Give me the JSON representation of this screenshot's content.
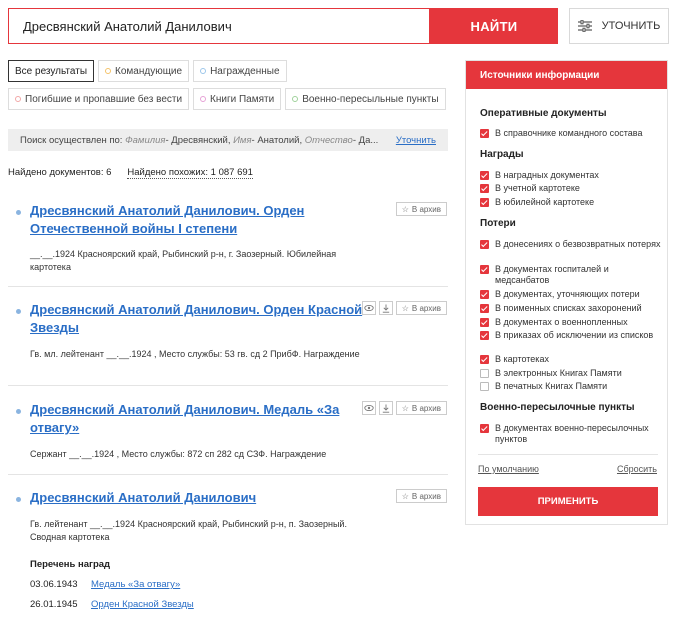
{
  "search": {
    "value": "Дресвянский Анатолий Данилович",
    "button": "НАЙТИ",
    "refine": "УТОЧНИТЬ",
    "accent": "#e5363c"
  },
  "tabs": [
    {
      "label": "Все результаты",
      "dot": ""
    },
    {
      "label": "Командующие",
      "dot": "#f4c36a"
    },
    {
      "label": "Награжденные",
      "dot": "#9cc6ea"
    },
    {
      "label": "Погибшие и пропавшие без вести",
      "dot": "#f2a7a7"
    },
    {
      "label": "Книги Памяти",
      "dot": "#e6a1d6"
    },
    {
      "label": "Военно-пересыльные пункты",
      "dot": "#9fd19a"
    }
  ],
  "query": {
    "prefix": "Поиск осуществлен по:",
    "f1_name": "Фамилия",
    "f1_value": " - Дресвянский,",
    "f2_name": "Имя",
    "f2_value": " - Анатолий,",
    "f3_name": "Отчество",
    "f3_value": " - Да...",
    "refine_link": "Уточнить"
  },
  "counts": {
    "found": "Найдено документов: 6",
    "similar": "Найдено похожих: 1 087 691"
  },
  "archive_label": "В архив",
  "results": [
    {
      "title": "Дресвянский Анатолий Данилович. Орден Отечественной войны I степени",
      "desc": "__.__.1924 Красноярский край, Рыбинский р-н, г. Заозерный. Юбилейная картотека"
    },
    {
      "title": "Дресвянский Анатолий Данилович. Орден Красной Звезды",
      "desc": "Гв. мл. лейтенант __.__.1924 , Место службы: 53 гв. сд 2 ПрибФ. Награждение"
    },
    {
      "title": "Дресвянский Анатолий Данилович. Медаль «За отвагу»",
      "desc": "Сержант __.__.1924 , Место службы: 872 сп 282 сд СЗФ. Награждение"
    },
    {
      "title": "Дресвянский Анатолий Данилович",
      "desc": "Гв. лейтенант __.__.1924 Красноярский край, Рыбинский р-н, п. Заозерный. Сводная картотека"
    }
  ],
  "awards": {
    "title": "Перечень наград",
    "items": [
      {
        "date": "03.06.1943",
        "name": "Медаль «За отвагу»"
      },
      {
        "date": "26.01.1945",
        "name": "Орден Красной Звезды"
      }
    ]
  },
  "sidebar": {
    "title": "Источники информации",
    "groups": [
      {
        "name": "Оперативные документы",
        "items": [
          {
            "label": "В справочнике командного состава",
            "checked": true
          }
        ]
      },
      {
        "name": "Награды",
        "items": [
          {
            "label": "В наградных документах",
            "checked": true
          },
          {
            "label": "В учетной картотеке",
            "checked": true
          },
          {
            "label": "В юбилейной картотеке",
            "checked": true
          }
        ]
      },
      {
        "name": "Потери",
        "items": [
          {
            "label": "В донесениях о безвозвратных потерях",
            "checked": true
          },
          {
            "label": "В документах госпиталей и медсанбатов",
            "checked": true
          },
          {
            "label": "В документах, уточняющих потери",
            "checked": true
          },
          {
            "label": "В поименных списках захоронений",
            "checked": true
          },
          {
            "label": "В документах о военнопленных",
            "checked": true
          },
          {
            "label": "В приказах об исключении из списков",
            "checked": true
          },
          {
            "label": "В картотеках",
            "checked": true
          },
          {
            "label": "В электронных Книгах Памяти",
            "checked": false
          },
          {
            "label": "В печатных Книгах Памяти",
            "checked": false
          }
        ]
      },
      {
        "name": "Военно-пересылочные пункты",
        "items": [
          {
            "label": "В документах военно-пересылочных пунктов",
            "checked": true
          }
        ]
      }
    ],
    "default_link": "По умолчанию",
    "reset_link": "Сбросить",
    "apply": "ПРИМЕНИТЬ"
  }
}
